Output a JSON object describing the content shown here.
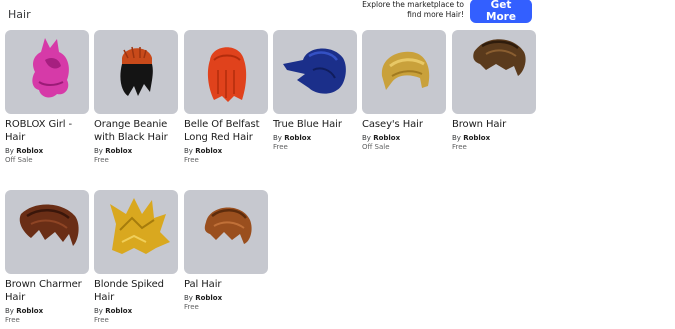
{
  "header": {
    "title": "Hair",
    "promo_text": "Explore the marketplace to find more Hair!",
    "button_label": "Get More"
  },
  "items": [
    {
      "name": "ROBLOX Girl - Hair",
      "by": "By",
      "creator": "Roblox",
      "price": "Off Sale",
      "color": "#d63aa8",
      "icon": "pink-hair-icon"
    },
    {
      "name": "Orange Beanie with Black Hair",
      "by": "By",
      "creator": "Roblox",
      "price": "Free",
      "color": "#c84a1a",
      "icon": "beanie-hair-icon"
    },
    {
      "name": "Belle Of Belfast Long Red Hair",
      "by": "By",
      "creator": "Roblox",
      "price": "Free",
      "color": "#e0421c",
      "icon": "red-hair-icon"
    },
    {
      "name": "True Blue Hair",
      "by": "By",
      "creator": "Roblox",
      "price": "Free",
      "color": "#1b2f8a",
      "icon": "blue-hair-icon"
    },
    {
      "name": "Casey's Hair",
      "by": "By",
      "creator": "Roblox",
      "price": "Off Sale",
      "color": "#c9a13b",
      "icon": "blonde-hair-icon"
    },
    {
      "name": "Brown Hair",
      "by": "By",
      "creator": "Roblox",
      "price": "Free",
      "color": "#5a3a1c",
      "icon": "brown-hair-icon"
    },
    {
      "name": "Brown Charmer Hair",
      "by": "By",
      "creator": "Roblox",
      "price": "Free",
      "color": "#6a2e16",
      "icon": "brown-charmer-hair-icon"
    },
    {
      "name": "Blonde Spiked Hair",
      "by": "By",
      "creator": "Roblox",
      "price": "Free",
      "color": "#d9a81f",
      "icon": "spiked-hair-icon"
    },
    {
      "name": "Pal Hair",
      "by": "By",
      "creator": "Roblox",
      "price": "Free",
      "color": "#9a4f1e",
      "icon": "pal-hair-icon"
    }
  ]
}
